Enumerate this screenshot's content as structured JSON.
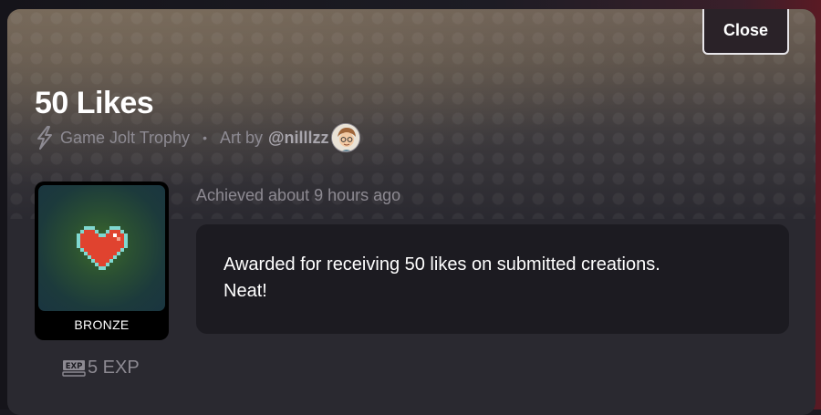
{
  "modal": {
    "close_label": "Close",
    "title": "50 Likes",
    "trophy_type": "Game Jolt Trophy",
    "separator": "•",
    "art_by_label": "Art by",
    "artist": "@nilllzz",
    "trophy_tier": "BRONZE",
    "exp_value": "5 EXP",
    "achieved": "Achieved about 9 hours ago",
    "description_line1": "Awarded for receiving 50 likes on submitted creations.",
    "description_line2": "Neat!"
  },
  "icons": {
    "trophy_type": "lightning-bolt-icon",
    "avatar": "artist-avatar",
    "heart": "pixel-heart-icon",
    "exp": "exp-icon"
  },
  "colors": {
    "heart": "#e0432f",
    "muted_text": "#8d8a92",
    "panel": "#1c1b21"
  }
}
